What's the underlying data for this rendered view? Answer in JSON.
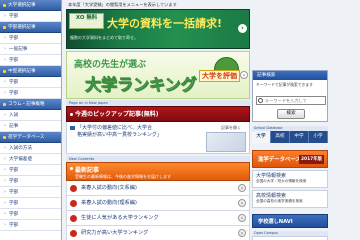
{
  "sidebar": {
    "items": [
      {
        "label": "大学選択記事",
        "head": true
      },
      {
        "label": "学部",
        "head": false
      },
      {
        "label": "学部選択記事",
        "head": true
      },
      {
        "label": "学部",
        "head": false
      },
      {
        "label": "一般記事",
        "head": false
      },
      {
        "label": "学部",
        "head": false
      },
      {
        "label": "中堅選択記事",
        "head": true
      },
      {
        "label": "学部",
        "head": false
      },
      {
        "label": "学部",
        "head": false
      },
      {
        "label": "コラム・記事概略",
        "head": true
      },
      {
        "label": "入試",
        "head": false
      },
      {
        "label": "記事",
        "head": false
      },
      {
        "label": "進学データベース",
        "head": true
      },
      {
        "label": "入試の方法",
        "head": false
      },
      {
        "label": "大学偏差値",
        "head": false
      },
      {
        "label": "学部",
        "head": false
      },
      {
        "label": "学部",
        "head": false
      },
      {
        "label": "学部",
        "head": false
      },
      {
        "label": "学部",
        "head": false
      },
      {
        "label": "学部",
        "head": false
      },
      {
        "label": "学部",
        "head": false
      }
    ]
  },
  "notice": "本年度「大学受験」の閲覧用をメニューを表示しています",
  "banner1": {
    "badge": "XO 無料",
    "title": "大学の資料を一括請求!",
    "subtitle": "複数の大学資料をまとめて取り寄せ。"
  },
  "banner2": {
    "line1": "高校の先生が選ぶ",
    "line2": "大学ランキング",
    "cta": "大学を評価"
  },
  "tiny_bar_1": "Page an in New Japan",
  "pickup": {
    "title": "今週のピックアップ記事(無料)",
    "tag": "記事を開く",
    "text_line1": "「大学付の偏差値に比べ、大学合",
    "text_line2": "格実績が高い中高一貫校ランキング」"
  },
  "new_bar": "New Contents",
  "orange": {
    "title": "最新記事",
    "subtitle": "受験生の最新情報は、今後の進学情報をお届けします"
  },
  "articles": [
    {
      "label": "来春入試の動向(文系編)"
    },
    {
      "label": "来春入試の動向(理系編)"
    },
    {
      "label": "生徒に人気がある大学ランキング"
    },
    {
      "label": "研究力が高い大学ランキング"
    }
  ],
  "search": {
    "title": "記事検索",
    "desc": "キーワードで記事が検索できます",
    "placeholder": "キーワードを入力して",
    "button": "検索"
  },
  "tabs_bar": "School Database",
  "tabs": [
    {
      "label": "大学",
      "active": true
    },
    {
      "label": "高校",
      "active": false
    },
    {
      "label": "中学",
      "active": false
    },
    {
      "label": "小学",
      "active": false
    }
  ],
  "database": {
    "title": "進学データベース",
    "year": "2017年版",
    "items": [
      {
        "title": "大学情報検索",
        "desc": "全国の大学・短大の情報を検索"
      },
      {
        "title": "高校情報検索",
        "desc": "全国の高校の進学実績を検索"
      }
    ]
  },
  "navi": {
    "title": "学校選しNAVI",
    "bar": "Open Campus"
  },
  "colors": {
    "accent_blue": "#2f5ea8",
    "pickup_red": "#b0161b",
    "orange": "#e05a0b",
    "banner_green": "#1b7a45"
  }
}
